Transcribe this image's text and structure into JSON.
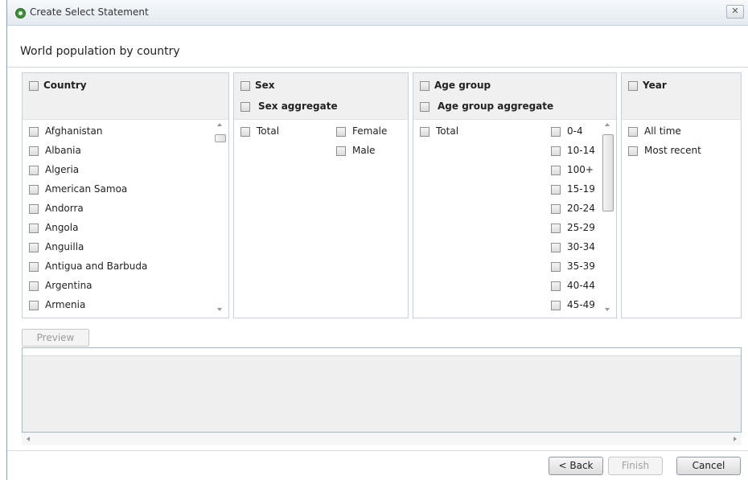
{
  "window": {
    "title": "Create Select Statement",
    "close_icon": "close-icon"
  },
  "header": {
    "title": "World population by country"
  },
  "panels": {
    "country": {
      "header": "Country",
      "items": [
        "Afghanistan",
        "Albania",
        "Algeria",
        "American Samoa",
        "Andorra",
        "Angola",
        "Anguilla",
        "Antigua and Barbuda",
        "Argentina",
        "Armenia"
      ]
    },
    "sex": {
      "header": "Sex",
      "aggregate_label": "Sex aggregate",
      "aggregate_items": [
        "Total"
      ],
      "items": [
        "Female",
        "Male"
      ]
    },
    "age_group": {
      "header": "Age group",
      "aggregate_label": "Age group aggregate",
      "aggregate_items": [
        "Total"
      ],
      "items": [
        "0-4",
        "10-14",
        "100+",
        "15-19",
        "20-24",
        "25-29",
        "30-34",
        "35-39",
        "40-44",
        "45-49"
      ]
    },
    "year": {
      "header": "Year",
      "items": [
        "All time",
        "Most recent"
      ]
    }
  },
  "preview": {
    "button_label": "Preview"
  },
  "footer": {
    "back_label": "< Back",
    "finish_label": "Finish",
    "cancel_label": "Cancel"
  }
}
